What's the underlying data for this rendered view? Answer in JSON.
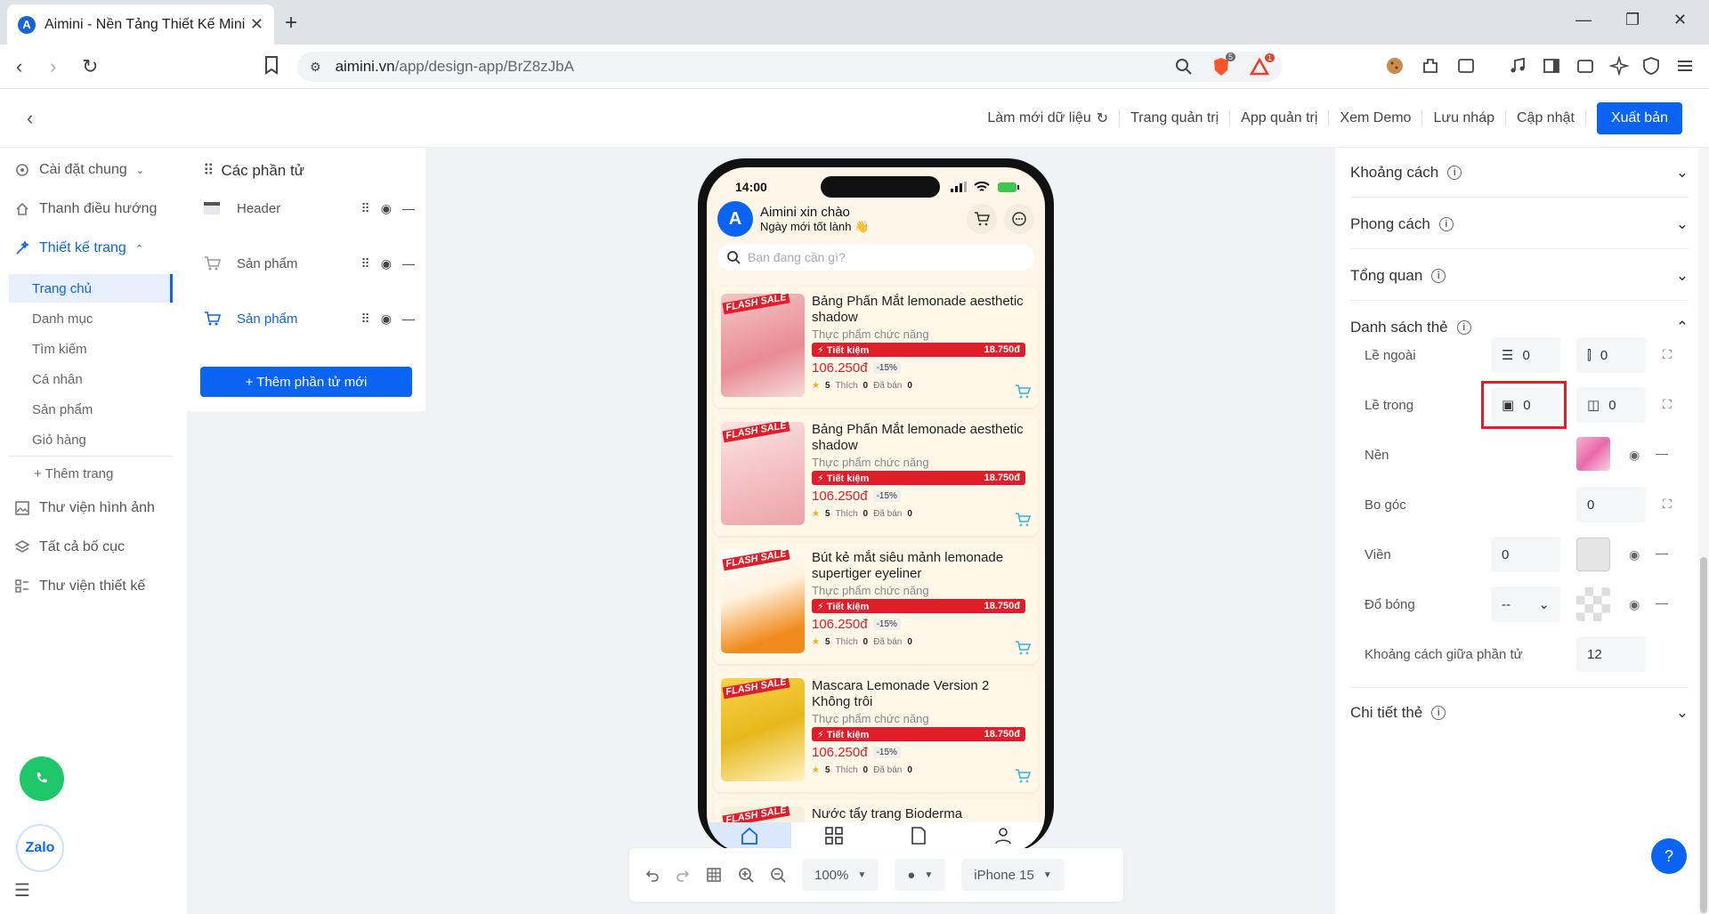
{
  "browser": {
    "tab_title": "Aimini - Nền Tảng Thiết Kế Mini",
    "url_domain": "aimini.vn",
    "url_path": "/app/design-app/BrZ8zJbA",
    "ext_badges": [
      "5",
      "1"
    ]
  },
  "topbar": {
    "actions": [
      "Làm mới dữ liệu",
      "Trang quản trị",
      "App quản trị",
      "Xem Demo",
      "Lưu nháp",
      "Cập nhật"
    ],
    "publish": "Xuất bản"
  },
  "sidebar": {
    "items": [
      "Cài đặt chung",
      "Thanh điều hướng",
      "Thiết kế trang"
    ],
    "subitems": [
      "Trang chủ",
      "Danh mục",
      "Tìm kiếm",
      "Cá nhân",
      "Sản phẩm",
      "Giỏ hàng"
    ],
    "add_page": "+ Thêm trang",
    "bottom_items": [
      "Thư viện hình ảnh",
      "Tất cả bố cục",
      "Thư viện thiết kế"
    ],
    "zalo": "Zalo"
  },
  "elements_panel": {
    "title": "Các phần tử",
    "rows": [
      "Header",
      "Sản phẩm",
      "Sản phẩm"
    ],
    "add_button": "+ Thêm phần tử mới"
  },
  "phone": {
    "time": "14:00",
    "greeting_title": "Aimini xin chào",
    "greeting_sub": "Ngày mới tốt lành 👋",
    "search_placeholder": "Bạn đang cần gì?",
    "flash_label": "FLASH SALE",
    "products": [
      {
        "name": "Bảng Phấn Mắt lemonade aesthetic shadow",
        "category": "Thực phẩm chức năng",
        "save_label": "⚡ Tiết kiệm",
        "save_amount": "18.750đ",
        "price": "106.250đ",
        "discount": "-15%",
        "rating": "5",
        "likes_label": "Thích",
        "likes": "0",
        "sold_label": "Đã bán",
        "sold": "0"
      },
      {
        "name": "Bảng Phấn Mắt lemonade aesthetic shadow",
        "category": "Thực phẩm chức năng",
        "save_label": "⚡ Tiết kiệm",
        "save_amount": "18.750đ",
        "price": "106.250đ",
        "discount": "-15%",
        "rating": "5",
        "likes_label": "Thích",
        "likes": "0",
        "sold_label": "Đã bán",
        "sold": "0"
      },
      {
        "name": "Bút kẻ mắt siêu mảnh lemonade supertiger eyeliner",
        "category": "Thực phẩm chức năng",
        "save_label": "⚡ Tiết kiệm",
        "save_amount": "18.750đ",
        "price": "106.250đ",
        "discount": "-15%",
        "rating": "5",
        "likes_label": "Thích",
        "likes": "0",
        "sold_label": "Đã bán",
        "sold": "0"
      },
      {
        "name": "Mascara Lemonade Version 2 Không trôi",
        "category": "Thực phẩm chức năng",
        "save_label": "⚡ Tiết kiệm",
        "save_amount": "18.750đ",
        "price": "106.250đ",
        "discount": "-15%",
        "rating": "5",
        "likes_label": "Thích",
        "likes": "0",
        "sold_label": "Đã bán",
        "sold": "0"
      },
      {
        "name": "Nước tẩy trang Bioderma",
        "category": "",
        "save_label": "",
        "save_amount": "",
        "price": "",
        "discount": "",
        "rating": "",
        "likes_label": "",
        "likes": "",
        "sold_label": "",
        "sold": ""
      }
    ]
  },
  "canvas_toolbar": {
    "zoom": "100%",
    "device": "iPhone 15"
  },
  "right_panel": {
    "sections": [
      "Khoảng cách",
      "Phong cách",
      "Tổng quan",
      "Danh sách thẻ",
      "Chi tiết thẻ"
    ],
    "rows": {
      "outer_margin": "Lề ngoài",
      "inner_padding": "Lề trong",
      "background": "Nền",
      "radius": "Bo góc",
      "border": "Viền",
      "shadow": "Đổ bóng",
      "gap": "Khoảng cách giữa phần tử"
    },
    "values": {
      "outer_v": "0",
      "outer_h": "0",
      "inner_v": "0",
      "inner_h": "0",
      "radius": "0",
      "border": "0",
      "shadow": "--",
      "gap": "12"
    }
  },
  "colors": {
    "accent": "#0b63f3",
    "sale_red": "#e11d2a",
    "highlight": "#e11d2a"
  }
}
